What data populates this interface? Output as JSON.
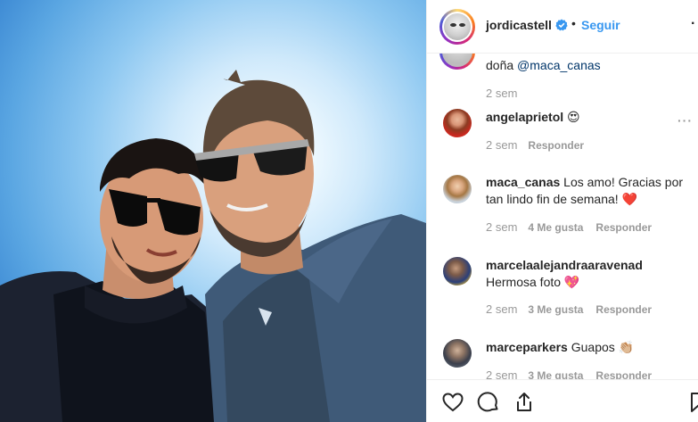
{
  "header": {
    "username": "jordicastell",
    "dot": "•",
    "follow_label": "Seguir",
    "more": "·"
  },
  "caption": {
    "text_prefix": "doña ",
    "mention": "@maca_canas",
    "time": "2 sem"
  },
  "comments": [
    {
      "username": "angelaprietol",
      "text": " 😍",
      "time": "2 sem",
      "likes": "",
      "reply": "Responder",
      "more": "···"
    },
    {
      "username": "maca_canas",
      "text": " Los amo! Gracias por tan lindo fin de semana! ❤️",
      "time": "2 sem",
      "likes": "4 Me gusta",
      "reply": "Responder"
    },
    {
      "username": "marcelaalejandraaravenad",
      "text": "Hermosa foto 💖",
      "time": "2 sem",
      "likes": "3 Me gusta",
      "reply": "Responder"
    },
    {
      "username": "marceparkers",
      "text": " Guapos 👏🏼",
      "time": "2 sem",
      "likes": "3 Me gusta",
      "reply": "Responder"
    }
  ],
  "actions": [
    "heart-icon",
    "comment-icon",
    "share-icon",
    "bookmark-icon"
  ],
  "colors": {
    "link": "#3897f0",
    "mention": "#003569",
    "muted": "#999999",
    "heart": "#ed4956"
  }
}
